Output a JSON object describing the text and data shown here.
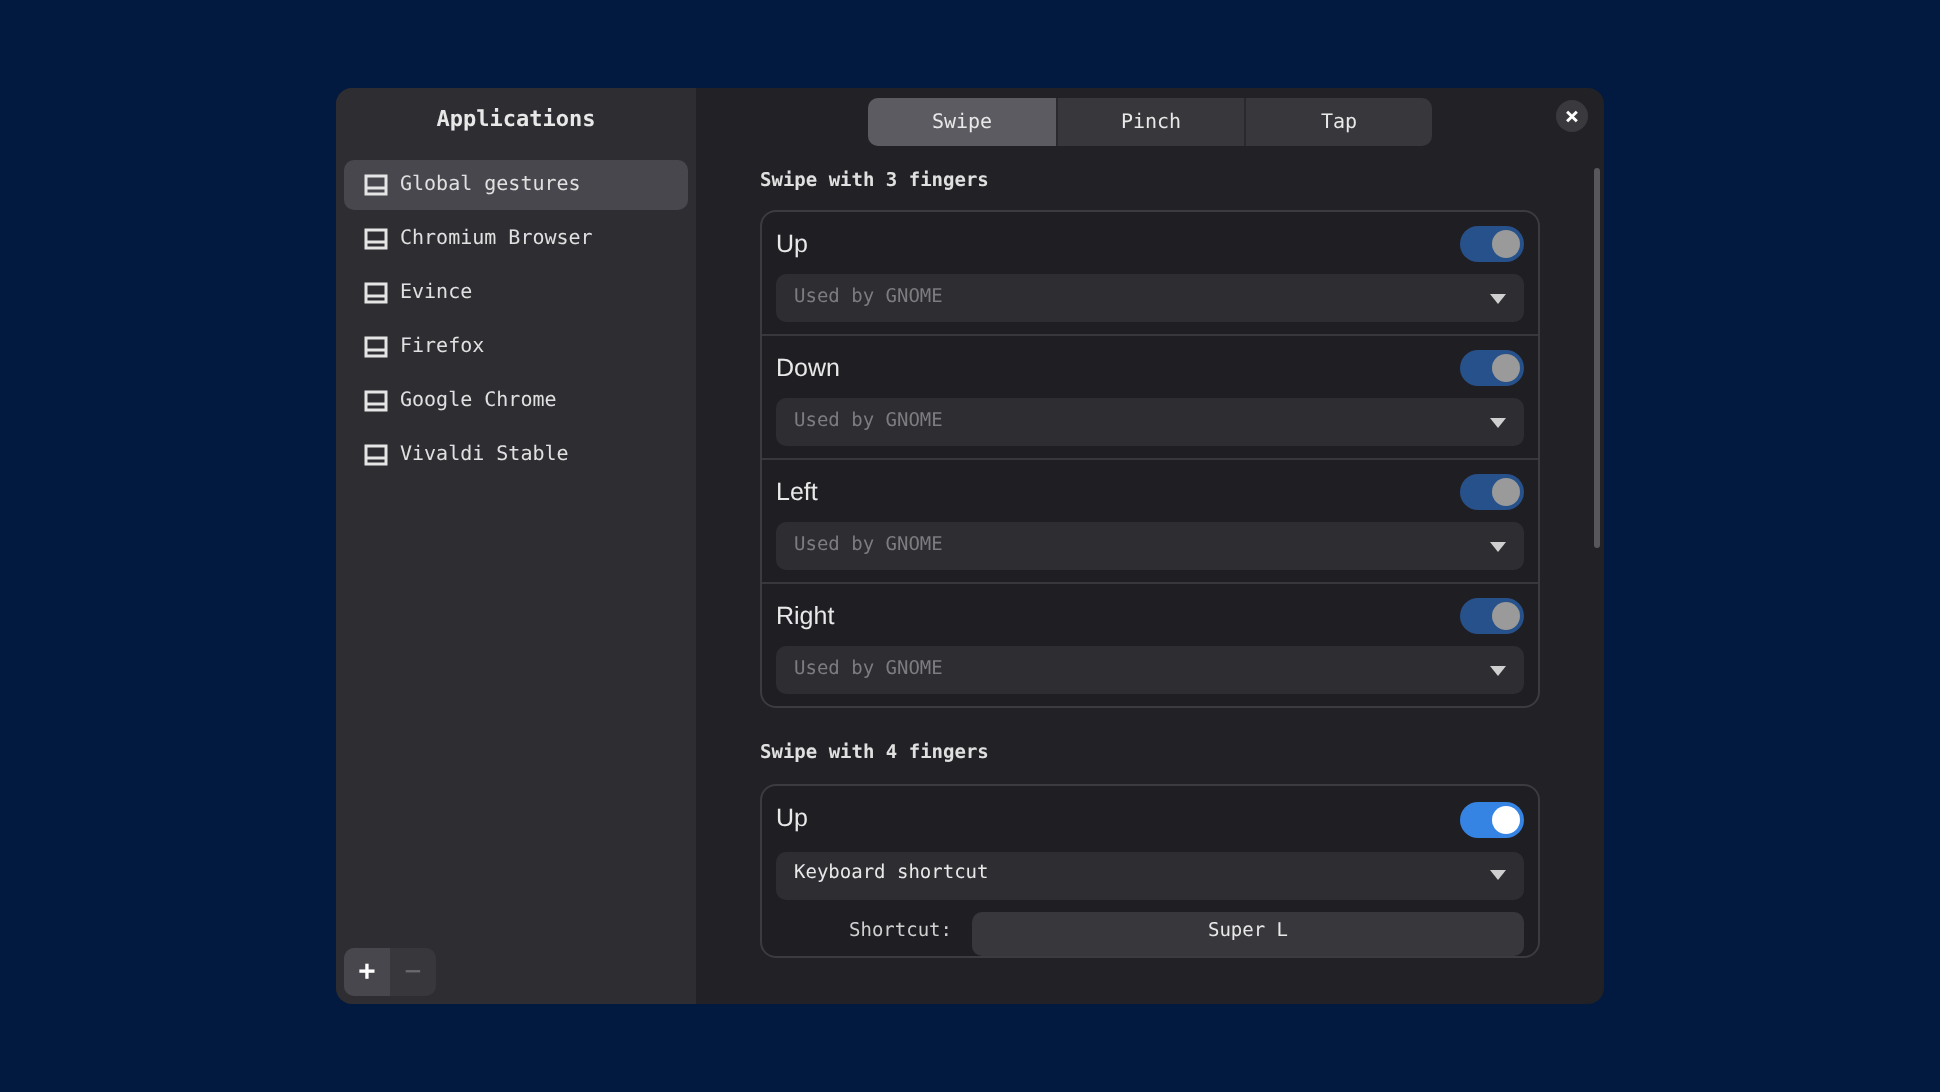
{
  "sidebar": {
    "title": "Applications",
    "items": [
      {
        "label": "Global gestures",
        "selected": true
      },
      {
        "label": "Chromium Browser",
        "selected": false
      },
      {
        "label": "Evince",
        "selected": false
      },
      {
        "label": "Firefox",
        "selected": false
      },
      {
        "label": "Google Chrome",
        "selected": false
      },
      {
        "label": "Vivaldi Stable",
        "selected": false
      }
    ],
    "add_button": {
      "label": "+",
      "disabled": false
    },
    "remove_button": {
      "label": "−",
      "disabled": true
    }
  },
  "tabs": [
    {
      "label": "Swipe",
      "selected": true
    },
    {
      "label": "Pinch",
      "selected": false
    },
    {
      "label": "Tap",
      "selected": false
    }
  ],
  "close_button": {
    "label": "×"
  },
  "sections": [
    {
      "title": "Swipe with 3 fingers",
      "gestures": [
        {
          "label": "Up",
          "on": true,
          "disabled": true,
          "action": "Used by GNOME"
        },
        {
          "label": "Down",
          "on": true,
          "disabled": true,
          "action": "Used by GNOME"
        },
        {
          "label": "Left",
          "on": true,
          "disabled": true,
          "action": "Used by GNOME"
        },
        {
          "label": "Right",
          "on": true,
          "disabled": true,
          "action": "Used by GNOME"
        }
      ]
    },
    {
      "title": "Swipe with 4 fingers",
      "gestures": [
        {
          "label": "Up",
          "on": true,
          "disabled": false,
          "action": "Keyboard shortcut",
          "shortcut_label": "Shortcut:",
          "shortcut": "Super L"
        }
      ]
    }
  ]
}
